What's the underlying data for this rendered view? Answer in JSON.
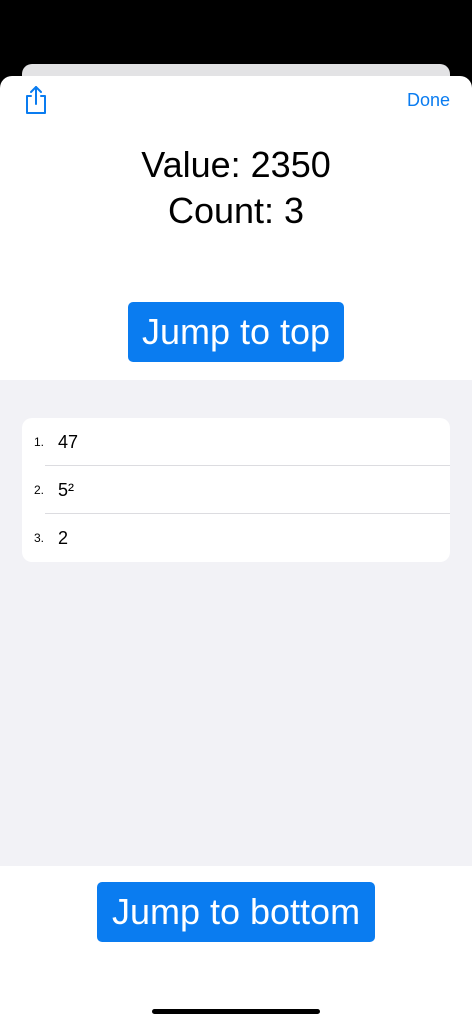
{
  "header": {
    "share_icon": "share-icon",
    "done_label": "Done"
  },
  "stats": {
    "value_line": "Value: 2350",
    "count_line": "Count: 3"
  },
  "buttons": {
    "jump_top_label": "Jump to top",
    "jump_bottom_label": "Jump to bottom"
  },
  "list": {
    "items": [
      {
        "number": "1.",
        "text": "47"
      },
      {
        "number": "2.",
        "text": "5²"
      },
      {
        "number": "3.",
        "text": "2"
      }
    ]
  },
  "colors": {
    "accent": "#0a7cf0",
    "list_background": "#f2f2f6",
    "sheet_background": "#ffffff"
  }
}
